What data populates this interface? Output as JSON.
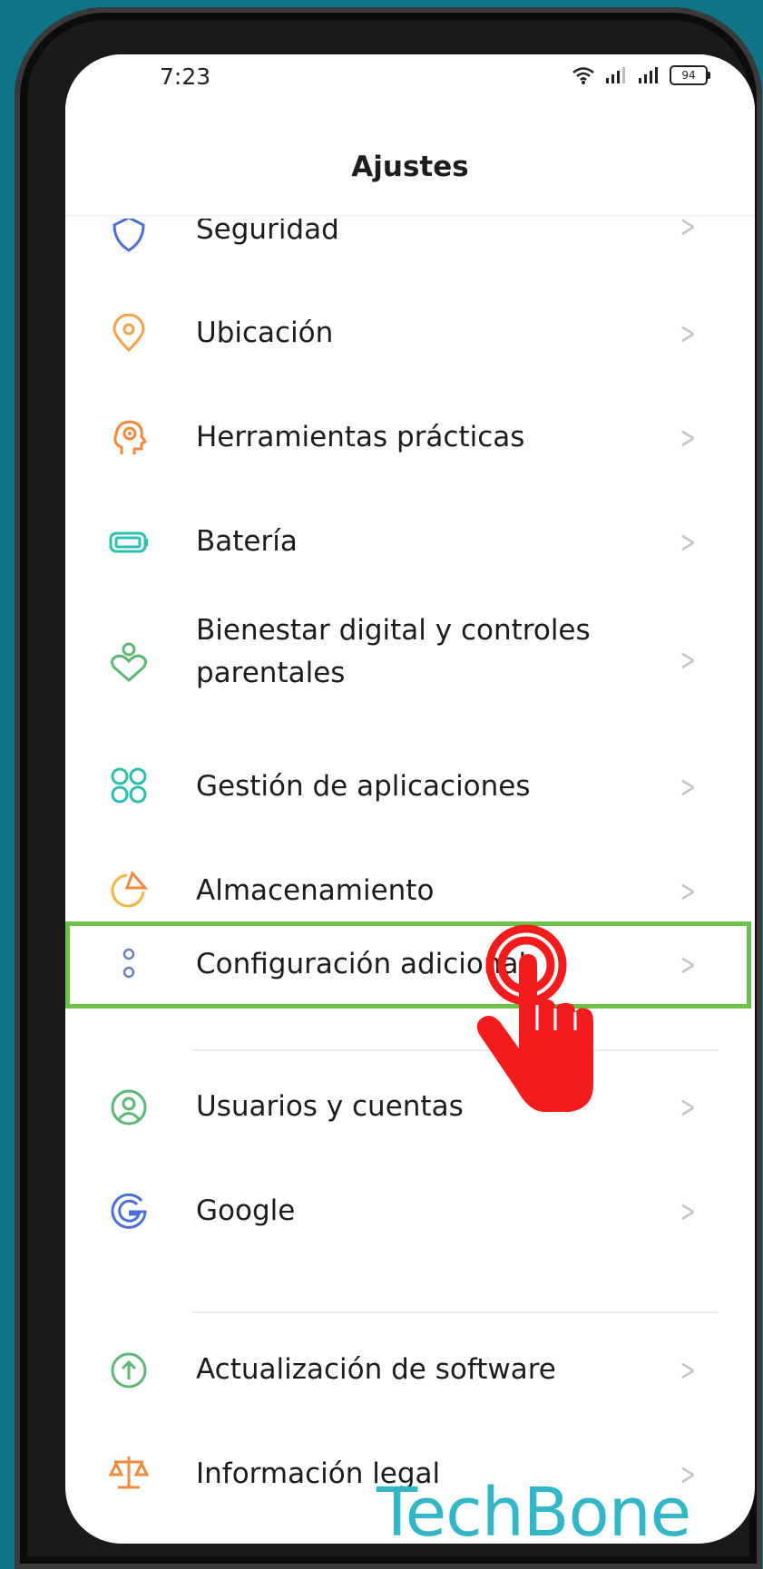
{
  "status_bar": {
    "time": "7:23",
    "battery": "94"
  },
  "header": {
    "title": "Ajustes"
  },
  "items": [
    {
      "label": "Seguridad",
      "icon": "shield-icon",
      "color": "#4a6fd8"
    },
    {
      "label": "Ubicación",
      "icon": "location-icon",
      "color": "#f4a24a"
    },
    {
      "label": "Herramientas prácticas",
      "icon": "tools-head-icon",
      "color": "#f08a3c"
    },
    {
      "label": "Batería",
      "icon": "battery-icon",
      "color": "#2bbfae"
    },
    {
      "label_line1": "Bienestar digital y controles",
      "label_line2": "parentales",
      "icon": "heart-person-icon",
      "color": "#5cb874"
    },
    {
      "label": "Gestión de aplicaciones",
      "icon": "apps-icon",
      "color": "#2bbfae"
    },
    {
      "label": "Almacenamiento",
      "icon": "storage-pie-icon",
      "color": "#f4b642"
    },
    {
      "label": "Configuración adicional",
      "icon": "more-settings-icon",
      "color": "#6b7fbf"
    },
    {
      "label": "Usuarios y cuentas",
      "icon": "user-icon",
      "color": "#5cb874"
    },
    {
      "label": "Google",
      "icon": "google-icon",
      "color": "#4a6fd8"
    },
    {
      "label": "Actualización de software",
      "icon": "update-arrow-icon",
      "color": "#5cb874"
    },
    {
      "label": "Información legal",
      "icon": "scales-icon",
      "color": "#f08a3c"
    }
  ],
  "watermark": "TechBone",
  "colors": {
    "highlight": "#6ac24a",
    "hand": "#f21c1c",
    "background": "#0f7486"
  }
}
